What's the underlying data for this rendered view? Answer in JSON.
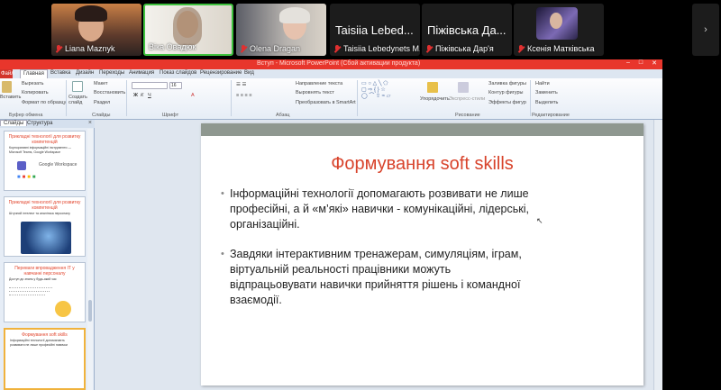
{
  "participants": [
    {
      "name": "Liana Maznyk",
      "muted": true,
      "video": true
    },
    {
      "name": "Віка Овадюк",
      "muted": false,
      "video": true,
      "active": true
    },
    {
      "name": "Olena Dragan",
      "muted": true,
      "video": true
    },
    {
      "name": "Taisiia Lebedynets M...",
      "display": "Taisiia Lebed...",
      "muted": true,
      "video": false
    },
    {
      "name": "Піжівська Дар'я",
      "display": "Піжівська Да...",
      "muted": true,
      "video": false
    },
    {
      "name": "Ксенія Матківська",
      "muted": true,
      "video": true
    }
  ],
  "more_icon": "chevron-right-icon",
  "ppt": {
    "window_title": "Вступ - Microsoft PowerPoint (Сбой активации продукта)",
    "file_tab": "Файл",
    "tabs": [
      "Главная",
      "Вставка",
      "Дизайн",
      "Переходы",
      "Анимация",
      "Показ слайдов",
      "Рецензирование",
      "Вид"
    ],
    "ribbon": {
      "clipboard": {
        "cut": "Вырезать",
        "copy": "Копировать",
        "paste_format": "Формат по образцу",
        "group": "Буфер обмена",
        "paste": "Вставить"
      },
      "slides": {
        "new": "Создать слайд",
        "layout": "Макет",
        "reset": "Восстановить",
        "section": "Раздел",
        "group": "Слайды"
      },
      "font_group": "Шрифт",
      "font_size": "16",
      "paragraph": {
        "text_direction": "Направление текста",
        "align_text": "Выровнять текст",
        "smartart": "Преобразовать в SmartArt",
        "group": "Абзац"
      },
      "drawing": {
        "arrange": "Упорядочить",
        "quick_styles": "Экспресс-стили",
        "fill": "Заливка фигуры",
        "outline": "Контур фигуры",
        "effects": "Эффекты фигур",
        "group": "Рисование"
      },
      "editing": {
        "find": "Найти",
        "replace": "Заменить",
        "select": "Выделить",
        "group": "Редактирование"
      }
    },
    "panel_tabs": [
      "Слайды",
      "Структура"
    ],
    "thumbnails": [
      {
        "title": "Прикладні технології для розвитку компетенцій",
        "sub": "Корпоративні інформаційні інструменти — Microsoft Teams, Google Workspace",
        "logo": "Google Workspace"
      },
      {
        "title": "Прикладні технології для розвитку компетенцій",
        "sub": "Штучний інтелект та аналітика персоналу"
      },
      {
        "title": "Переваги впровадження ІТ у навчанні персоналу",
        "sub": "Доступ до знань у будь-який час"
      },
      {
        "title": "Формування soft skills",
        "sub": "Інформаційні технології допомагають розвивати не лише професійні навички"
      }
    ],
    "slide": {
      "title": "Формування soft skills",
      "bullets": [
        "Інформаційні технології допомагають розвивати не лише професійні, а й «м’які» навички - комунікаційні, лідерські, організаційні.",
        "Завдяки інтерактивним тренажерам, симуляціям, іграм, віртуальній реальності працівники можуть відпрацьовувати навички прийняття рішень і командної взаємодії."
      ]
    }
  }
}
